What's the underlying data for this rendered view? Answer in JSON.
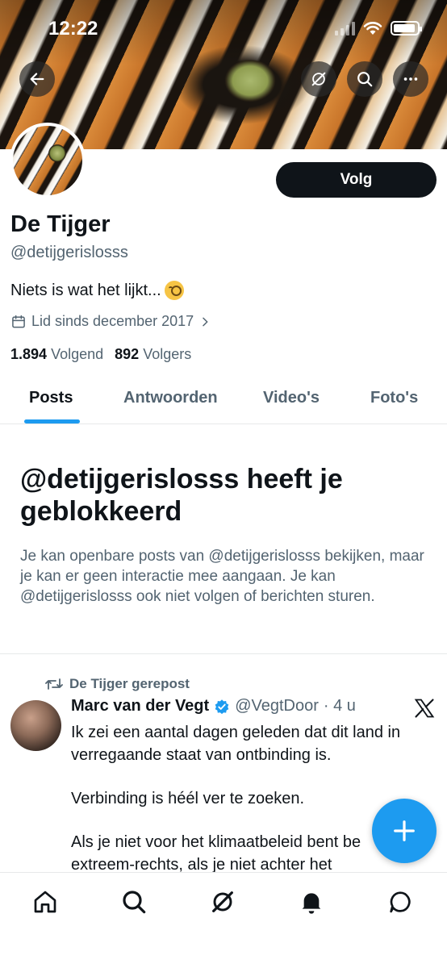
{
  "status_bar": {
    "time": "12:22"
  },
  "banner": {
    "description_icons": [
      "back-arrow-icon",
      "grok-icon",
      "search-icon",
      "more-icon"
    ]
  },
  "profile": {
    "follow_label": "Volg",
    "name": "De Tijger",
    "handle": "@detijgerislosss",
    "bio": "Niets is wat het lijkt...",
    "bio_emoji": "face-with-monocle",
    "joined": "Lid sinds december 2017",
    "following_count": "1.894",
    "following_label": "Volgend",
    "followers_count": "892",
    "followers_label": "Volgers"
  },
  "tabs": [
    {
      "label": "Posts",
      "active": true
    },
    {
      "label": "Antwoorden",
      "active": false
    },
    {
      "label": "Video's",
      "active": false
    },
    {
      "label": "Foto's",
      "active": false
    }
  ],
  "blocked": {
    "title": "@detijgerislosss heeft je geblokkeerd",
    "description": "Je kan openbare posts van @detijgerislosss bekijken, maar je kan er geen interactie mee aangaan. Je kan @detijgerislosss ook niet volgen of berichten sturen."
  },
  "post": {
    "repost_label": "De Tijger gerepost",
    "author": "Marc van der Vegt",
    "author_handle": "@VegtDoor",
    "time": "· 4 u",
    "paragraphs": [
      "Ik zei een aantal dagen geleden dat dit land in verregaande staat van ontbinding is.",
      "Verbinding is héél ver te zoeken.",
      "Als je niet voor het klimaatbeleid bent be extreem-rechts, als je niet achter het"
    ]
  },
  "colors": {
    "accent": "#1d9bf0",
    "text_primary": "#0f1419",
    "text_secondary": "#536471"
  },
  "bottom_nav": [
    "home-icon",
    "search-icon",
    "grok-icon",
    "notifications-icon",
    "messages-icon"
  ]
}
